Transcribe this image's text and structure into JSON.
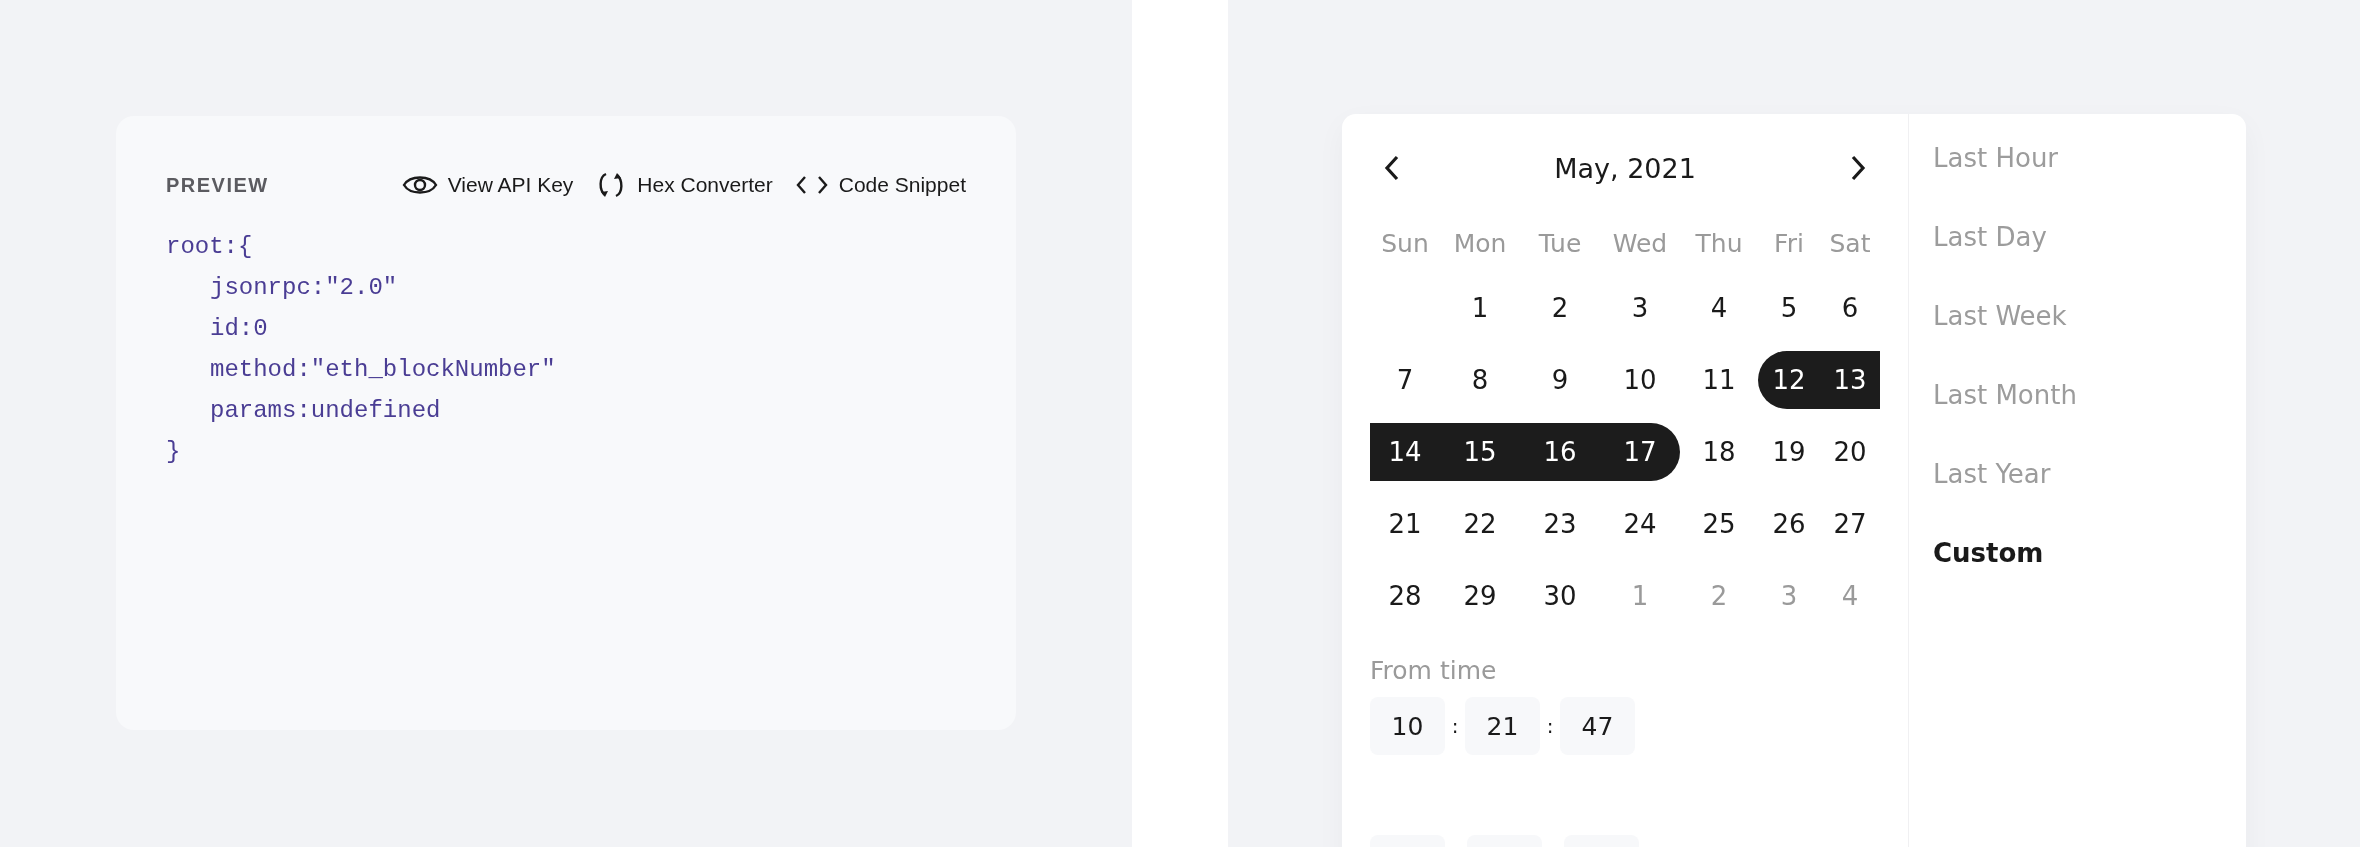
{
  "preview": {
    "title": "PREVIEW",
    "actions": [
      {
        "kind": "eye",
        "label": "View API Key"
      },
      {
        "kind": "convert",
        "label": "Hex Converter"
      },
      {
        "kind": "code",
        "label": "Code Snippet"
      }
    ],
    "code": [
      {
        "text": "root:{",
        "indented": false
      },
      {
        "text": "jsonrpc:\"2.0\"",
        "indented": true
      },
      {
        "text": "id:0",
        "indented": true
      },
      {
        "text": "method:\"eth_blockNumber\"",
        "indented": true
      },
      {
        "text": "params:undefined",
        "indented": true
      },
      {
        "text": "}",
        "indented": false
      }
    ]
  },
  "calendar": {
    "month": "May, 2021",
    "weekdays": [
      "Sun",
      "Mon",
      "Tue",
      "Wed",
      "Thu",
      "Fri",
      "Sat"
    ],
    "weeks": [
      [
        {
          "kind": "blank"
        },
        {
          "kind": "day",
          "label": "1",
          "selected": false,
          "muted": false
        },
        {
          "kind": "day",
          "label": "2",
          "selected": false,
          "muted": false
        },
        {
          "kind": "day",
          "label": "3",
          "selected": false,
          "muted": false
        },
        {
          "kind": "day",
          "label": "4",
          "selected": false,
          "muted": false
        },
        {
          "kind": "day",
          "label": "5",
          "selected": false,
          "muted": false
        },
        {
          "kind": "day",
          "label": "6",
          "selected": false,
          "muted": false
        }
      ],
      [
        {
          "kind": "day",
          "label": "7",
          "selected": false,
          "muted": false
        },
        {
          "kind": "day",
          "label": "8",
          "selected": false,
          "muted": false
        },
        {
          "kind": "day",
          "label": "9",
          "selected": false,
          "muted": false
        },
        {
          "kind": "day",
          "label": "10",
          "selected": false,
          "muted": false
        },
        {
          "kind": "day",
          "label": "11",
          "selected": false,
          "muted": false
        },
        {
          "kind": "day",
          "label": "12",
          "selected": true,
          "muted": false
        },
        {
          "kind": "day",
          "label": "13",
          "selected": true,
          "muted": false
        }
      ],
      [
        {
          "kind": "day",
          "label": "14",
          "selected": true,
          "muted": false
        },
        {
          "kind": "day",
          "label": "15",
          "selected": true,
          "muted": false
        },
        {
          "kind": "day",
          "label": "16",
          "selected": true,
          "muted": false
        },
        {
          "kind": "day",
          "label": "17",
          "selected": true,
          "muted": false
        },
        {
          "kind": "day",
          "label": "18",
          "selected": false,
          "muted": false
        },
        {
          "kind": "day",
          "label": "19",
          "selected": false,
          "muted": false
        },
        {
          "kind": "day",
          "label": "20",
          "selected": false,
          "muted": false
        }
      ],
      [
        {
          "kind": "day",
          "label": "21",
          "selected": false,
          "muted": false
        },
        {
          "kind": "day",
          "label": "22",
          "selected": false,
          "muted": false
        },
        {
          "kind": "day",
          "label": "23",
          "selected": false,
          "muted": false
        },
        {
          "kind": "day",
          "label": "24",
          "selected": false,
          "muted": false
        },
        {
          "kind": "day",
          "label": "25",
          "selected": false,
          "muted": false
        },
        {
          "kind": "day",
          "label": "26",
          "selected": false,
          "muted": false
        },
        {
          "kind": "day",
          "label": "27",
          "selected": false,
          "muted": false
        }
      ],
      [
        {
          "kind": "day",
          "label": "28",
          "selected": false,
          "muted": false
        },
        {
          "kind": "day",
          "label": "29",
          "selected": false,
          "muted": false
        },
        {
          "kind": "day",
          "label": "30",
          "selected": false,
          "muted": false
        },
        {
          "kind": "day",
          "label": "1",
          "selected": false,
          "muted": true
        },
        {
          "kind": "day",
          "label": "2",
          "selected": false,
          "muted": true
        },
        {
          "kind": "day",
          "label": "3",
          "selected": false,
          "muted": true
        },
        {
          "kind": "day",
          "label": "4",
          "selected": false,
          "muted": true
        }
      ]
    ],
    "from_time": {
      "label": "From time",
      "hours": "10",
      "minutes": "21",
      "seconds": "47",
      "separator": ":"
    },
    "ranges": [
      {
        "label": "Last Hour",
        "selected": false
      },
      {
        "label": "Last Day",
        "selected": false
      },
      {
        "label": "Last Week",
        "selected": false
      },
      {
        "label": "Last Month",
        "selected": false
      },
      {
        "label": "Last Year",
        "selected": false
      },
      {
        "label": "Custom",
        "selected": true
      }
    ]
  }
}
